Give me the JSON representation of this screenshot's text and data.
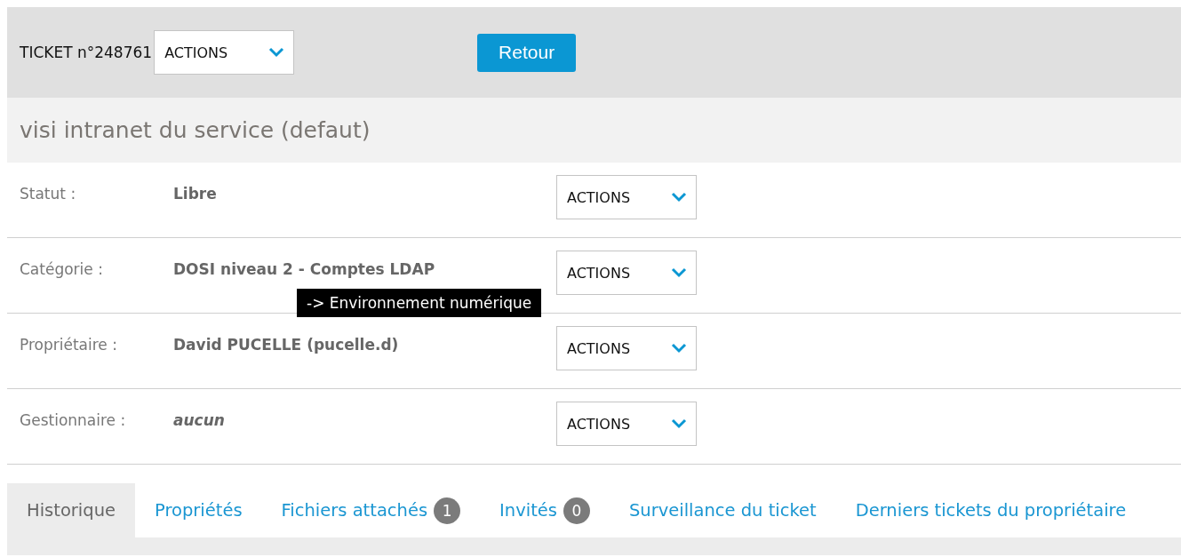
{
  "header": {
    "ticket": "TICKET n°248761",
    "actions": "ACTIONS",
    "back_button": "Retour"
  },
  "subtitle": "visi intranet du service (defaut)",
  "fields": [
    {
      "label": "Statut :",
      "value": "Libre",
      "italic": false,
      "actions": "ACTIONS"
    },
    {
      "label": "Catégorie :",
      "value": "DOSI niveau 2 - Comptes LDAP",
      "italic": false,
      "actions": "ACTIONS",
      "tooltip": "-> Environnement numérique"
    },
    {
      "label": "Propriétaire :",
      "value": "David PUCELLE (pucelle.d)",
      "italic": false,
      "actions": "ACTIONS"
    },
    {
      "label": "Gestionnaire :",
      "value": "aucun",
      "italic": true,
      "actions": "ACTIONS"
    }
  ],
  "tabs": [
    {
      "label": "Historique",
      "selected": true
    },
    {
      "label": "Propriétés",
      "selected": false
    },
    {
      "label": "Fichiers attachés",
      "selected": false,
      "count": "1"
    },
    {
      "label": "Invités",
      "selected": false,
      "count": "0"
    },
    {
      "label": "Surveillance du ticket",
      "selected": false
    },
    {
      "label": "Derniers tickets du propriétaire",
      "selected": false
    }
  ]
}
